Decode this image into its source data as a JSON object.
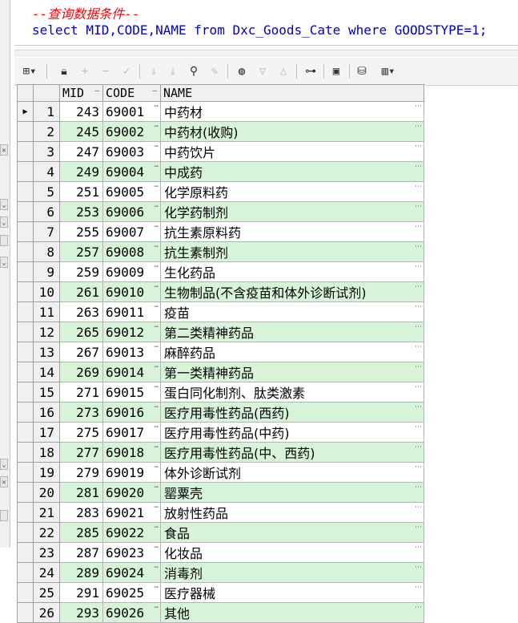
{
  "editor": {
    "comment": "--查询数据条件--",
    "sql": "select MID,CODE,NAME from Dxc_Goods_Cate where GOODSTYPE=1;"
  },
  "toolbar": {
    "icons": [
      "grid-menu-icon",
      "lock-icon",
      "add-row-icon",
      "delete-row-icon",
      "post-icon",
      "next-page-icon",
      "last-page-icon",
      "find-icon",
      "clear-icon",
      "query-by-example-icon",
      "filter-down-icon",
      "filter-up-icon",
      "explain-icon",
      "save-icon",
      "export-icon",
      "chart-icon"
    ]
  },
  "grid": {
    "headers": {
      "mid": "MID",
      "code": "CODE",
      "name": "NAME"
    },
    "rows": [
      {
        "n": "1",
        "mid": "243",
        "code": "69001",
        "name": "中药材"
      },
      {
        "n": "2",
        "mid": "245",
        "code": "69002",
        "name": "中药材(收购)"
      },
      {
        "n": "3",
        "mid": "247",
        "code": "69003",
        "name": "中药饮片"
      },
      {
        "n": "4",
        "mid": "249",
        "code": "69004",
        "name": "中成药"
      },
      {
        "n": "5",
        "mid": "251",
        "code": "69005",
        "name": "化学原料药"
      },
      {
        "n": "6",
        "mid": "253",
        "code": "69006",
        "name": "化学药制剂"
      },
      {
        "n": "7",
        "mid": "255",
        "code": "69007",
        "name": "抗生素原料药"
      },
      {
        "n": "8",
        "mid": "257",
        "code": "69008",
        "name": "抗生素制剂"
      },
      {
        "n": "9",
        "mid": "259",
        "code": "69009",
        "name": "生化药品"
      },
      {
        "n": "10",
        "mid": "261",
        "code": "69010",
        "name": "生物制品(不含疫苗和体外诊断试剂)"
      },
      {
        "n": "11",
        "mid": "263",
        "code": "69011",
        "name": "疫苗"
      },
      {
        "n": "12",
        "mid": "265",
        "code": "69012",
        "name": "第二类精神药品"
      },
      {
        "n": "13",
        "mid": "267",
        "code": "69013",
        "name": "麻醉药品"
      },
      {
        "n": "14",
        "mid": "269",
        "code": "69014",
        "name": "第一类精神药品"
      },
      {
        "n": "15",
        "mid": "271",
        "code": "69015",
        "name": "蛋白同化制剂、肽类激素"
      },
      {
        "n": "16",
        "mid": "273",
        "code": "69016",
        "name": "医疗用毒性药品(西药)"
      },
      {
        "n": "17",
        "mid": "275",
        "code": "69017",
        "name": "医疗用毒性药品(中药)"
      },
      {
        "n": "18",
        "mid": "277",
        "code": "69018",
        "name": "医疗用毒性药品(中、西药)"
      },
      {
        "n": "19",
        "mid": "279",
        "code": "69019",
        "name": "体外诊断试剂"
      },
      {
        "n": "20",
        "mid": "281",
        "code": "69020",
        "name": "罂粟壳"
      },
      {
        "n": "21",
        "mid": "283",
        "code": "69021",
        "name": "放射性药品"
      },
      {
        "n": "22",
        "mid": "285",
        "code": "69022",
        "name": "食品"
      },
      {
        "n": "23",
        "mid": "287",
        "code": "69023",
        "name": "化妆品"
      },
      {
        "n": "24",
        "mid": "289",
        "code": "69024",
        "name": "消毒剂"
      },
      {
        "n": "25",
        "mid": "291",
        "code": "69025",
        "name": "医疗器械"
      },
      {
        "n": "26",
        "mid": "293",
        "code": "69026",
        "name": "其他"
      }
    ]
  },
  "colors": {
    "comment": "#ff0000",
    "code": "#0000c0",
    "row_alt": "#d8f4d8"
  }
}
